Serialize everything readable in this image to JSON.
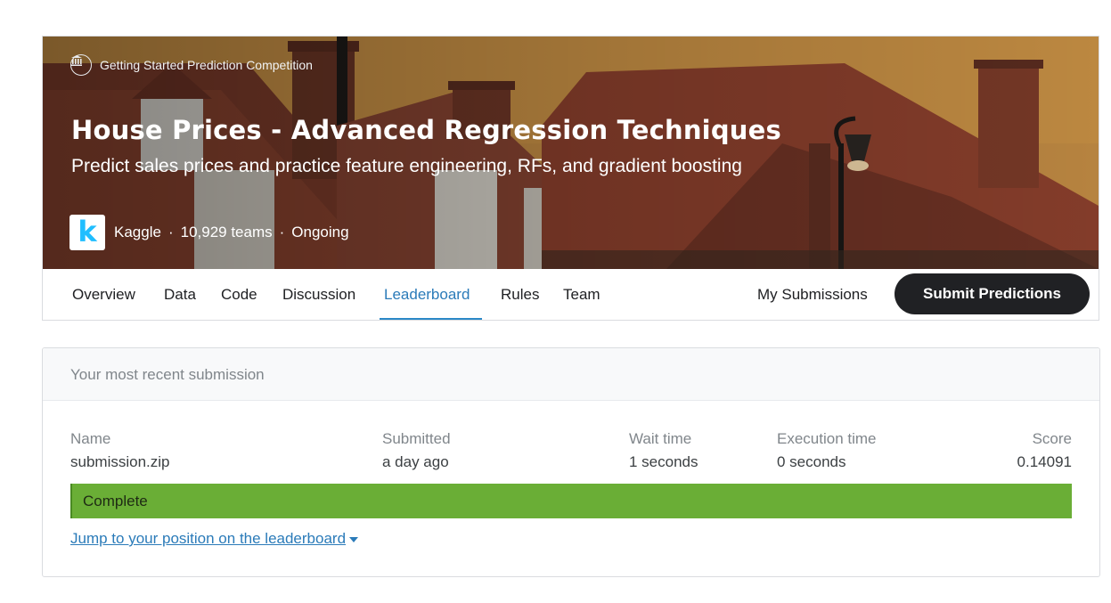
{
  "competition": {
    "kind_label": "Getting Started Prediction Competition",
    "title": "House Prices - Advanced Regression Techniques",
    "subtitle": "Predict sales prices and practice feature engineering, RFs, and gradient boosting",
    "host_logo_letter": "k",
    "host": "Kaggle",
    "separator": "·",
    "teams": "10,929 teams",
    "status": "Ongoing"
  },
  "tabs": [
    {
      "label": "Overview",
      "active": false
    },
    {
      "label": "Data",
      "active": false
    },
    {
      "label": "Code",
      "active": false
    },
    {
      "label": "Discussion",
      "active": false
    },
    {
      "label": "Leaderboard",
      "active": true
    },
    {
      "label": "Rules",
      "active": false
    },
    {
      "label": "Team",
      "active": false
    }
  ],
  "actions": {
    "my_submissions": "My Submissions",
    "submit_predictions": "Submit Predictions"
  },
  "submission": {
    "header": "Your most recent submission",
    "columns": [
      {
        "label": "Name",
        "value": "submission.zip"
      },
      {
        "label": "Submitted",
        "value": "a day ago"
      },
      {
        "label": "Wait time",
        "value": "1 seconds"
      },
      {
        "label": "Execution time",
        "value": "0 seconds"
      },
      {
        "label": "Score",
        "value": "0.14091"
      }
    ],
    "status": "Complete",
    "jump_link": "Jump to your position on the leaderboard"
  },
  "colors": {
    "accent": "#2b7bb9",
    "status_complete": "#6aae36",
    "button_dark": "#202124"
  },
  "icons": {
    "competition_kind": "bank-icon",
    "dropdown": "caret-down-icon"
  }
}
